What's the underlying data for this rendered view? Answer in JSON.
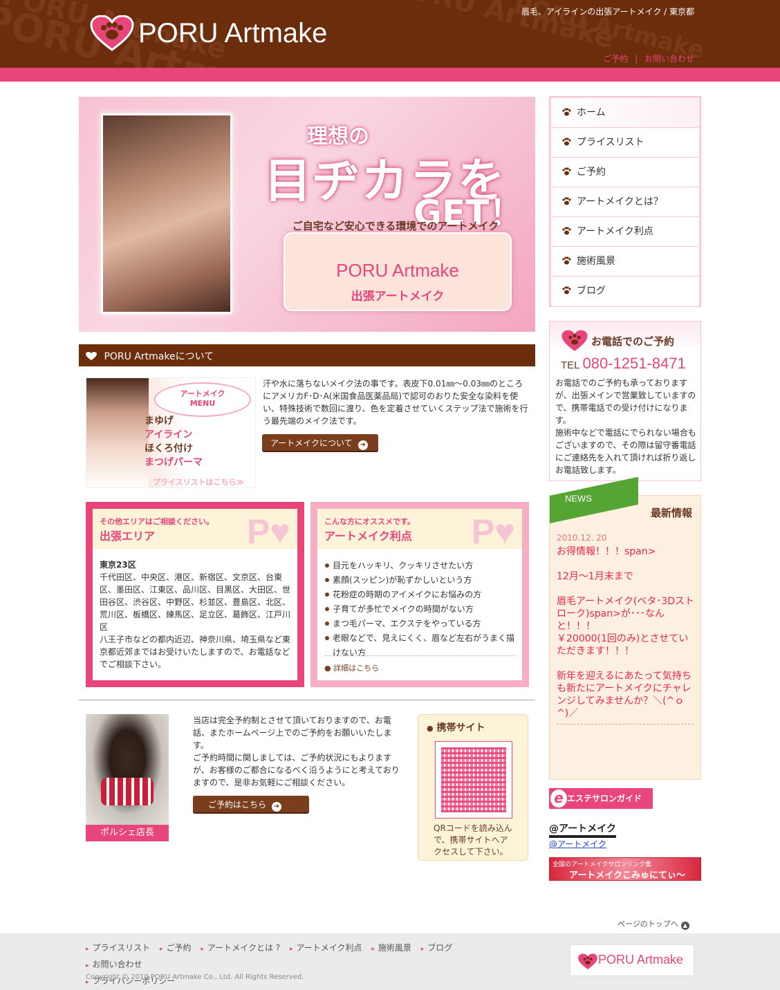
{
  "header": {
    "logo_text": "PORU Artmake",
    "tagline": "眉毛、アイラインの出張アートメイク / 東京都",
    "link_reserve": "ご予約",
    "link_sep": "|",
    "link_contact": "お問い合わせ",
    "watermark": "PORU Artmake"
  },
  "hero": {
    "line1": "理想の",
    "line2": "目ヂカラを",
    "line3": "GET！",
    "box_line1": "ご自宅など安心できる環境でのアートメイク",
    "box_line2": "PORU Artmake",
    "box_line3": "出張アートメイク"
  },
  "about": {
    "title": "PORU Artmakeについて",
    "menu_bubble_1": "アートメイク",
    "menu_bubble_2": "MENU",
    "menu_items": [
      "まゆげ",
      "アイライン",
      "ほくろ付け",
      "まつげパーマ"
    ],
    "menu_pricelist": "プライスリストはこちら≫",
    "text": "汗や水に落ちないメイク法の事です。表皮下0.01㎜～0.03㎜のところにアメリカF･D･A(米国食品医薬品局)で認可のおりた安全な染料を使い、特殊技術で数回に渡り、色を定着させていくステップ法で施術を行う最先端のメイク法です。",
    "button": "アートメイクについて"
  },
  "area_box": {
    "small": "その他エリアはご相談ください。",
    "title": "出張エリア",
    "subtitle": "東京23区",
    "body1": "千代田区、中央区、港区、新宿区、文京区、台東区、墨田区、江東区、品川区、目黒区、大田区、世田谷区、渋谷区、中野区、杉並区、豊島区、北区、荒川区、板橋区、練馬区、足立区、葛飾区、江戸川区",
    "body2": "八王子市などの都内近辺、神奈川県、埼玉県など東京都近郊まではお受けいたしますので、お電話などでご相談下さい。",
    "mark": "P♥"
  },
  "merit_box": {
    "small": "こんな方にオススメです。",
    "title": "アートメイク利点",
    "items": [
      "目元をハッキリ、クッキリさせたい方",
      "素顔(スッピン)が恥ずかしいという方",
      "花粉症の時期のアイメイクにお悩みの方",
      "子育てが多忙でメイクの時間がない方",
      "まつ毛パーマ、エクステをやっている方",
      "老眼などで、見えにくく、眉など左右がうまく描けない方"
    ],
    "more": "詳細はこちら",
    "mark": "P♥"
  },
  "owner": {
    "label": "ポルシェ店長",
    "text": "当店は完全予約制とさせて頂いておりますので、お電話、またホームページ上でのご予約をお願いいたします。\nご予約時間に関しましては、ご予約状況にもよりますが、お客様のご都合になるべく沿うようにと考えておりますので、是非お気軽にご相談ください。",
    "button": "ご予約はこちら"
  },
  "mobile": {
    "title": "携帯サイト",
    "caption": "QRコードを読み込んで、携帯サイトへアクセスして下さい。"
  },
  "nav": {
    "items": [
      "ホーム",
      "プライスリスト",
      "ご予約",
      "アートメイクとは？",
      "アートメイク利点",
      "施術風景",
      "ブログ"
    ]
  },
  "tel": {
    "title": "お電話でのご予約",
    "tel_label": "TEL",
    "number": "080-1251-8471",
    "body": "お電話でのご予約も承っておりますが、出張メインで営業致していますので、携帯電話での受け付けになります。\n施術中などで電話にでられない場合もございますので、その際は留守番電話にご連絡先を入れて頂ければ折り返しお電話致します。"
  },
  "news": {
    "ribbon": "NEWS",
    "title": "最新情報",
    "date": "2010.12. 20",
    "body": "お得情報！！！span>\n\n12月～1月末まで\n\n眉毛アートメイク(ベタ･3Dストローク)span>が･･･なんと！！！\n￥20000(1回のみ)とさせていただきます！！！\n\n新年を迎えるにあたって気持ちも新たにアートメイクにチャレンジしてみませんか？＼(^ｏ^)／"
  },
  "side_links": {
    "esthe": "エステサロンガイド",
    "esthe_e": "e",
    "at_logo": "@アートメイク",
    "at_link": "@アートメイク",
    "banner_small": "全国のアートメイクサロンリンク集",
    "banner_big": "アートメイクこみゅにてぃ～"
  },
  "pagetop": "ページのトップへ",
  "footer": {
    "links": [
      "プライスリスト",
      "ご予約",
      "アートメイクとは ?",
      "アートメイク利点",
      "施術風景",
      "ブログ",
      "お問い合わせ",
      "プライバシーポリシー"
    ],
    "copyright": "Copyright © 2010 PORU Artmake Co., Ltd. All Rights Reserved.",
    "logo_text": "PORU Artmake"
  },
  "colors": {
    "brown": "#6b2d0c",
    "pink": "#e8457a",
    "light_pink": "#f7aec5",
    "news_red": "#e8254a"
  }
}
